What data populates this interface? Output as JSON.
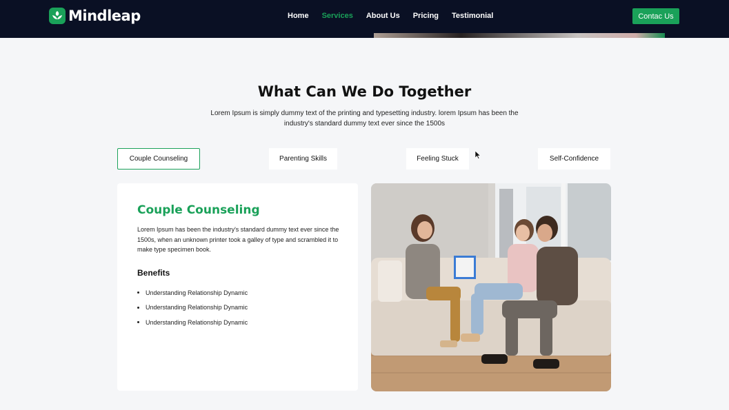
{
  "header": {
    "brand": "Mindleap",
    "nav": [
      {
        "label": "Home",
        "active": false
      },
      {
        "label": "Services",
        "active": true
      },
      {
        "label": "About Us",
        "active": false
      },
      {
        "label": "Pricing",
        "active": false
      },
      {
        "label": "Testimonial",
        "active": false
      }
    ],
    "contact_label": "Contac Us"
  },
  "section": {
    "title": "What Can We Do Together",
    "subtitle": "Lorem Ipsum is simply dummy text of the printing and typesetting industry. lorem Ipsum has been the industry's standard dummy text ever since the 1500s"
  },
  "tabs": [
    {
      "label": "Couple Counseling",
      "active": true
    },
    {
      "label": "Parenting Skills",
      "active": false
    },
    {
      "label": "Feeling Stuck",
      "active": false
    },
    {
      "label": "Self-Confidence",
      "active": false
    }
  ],
  "card": {
    "title": "Couple Counseling",
    "description": "Lorem Ipsum has been the industry's standard dummy text ever since the 1500s, when an unknown printer took a galley of type and scrambled it to make type specimen book.",
    "benefits_title": "Benefits",
    "benefits": [
      "Understanding Relationship Dynamic",
      "Understanding Relationship Dynamic",
      "Understanding Relationship Dynamic"
    ]
  },
  "colors": {
    "accent": "#1aa159",
    "header_bg": "#0a1024",
    "page_bg": "#f5f6f8"
  }
}
